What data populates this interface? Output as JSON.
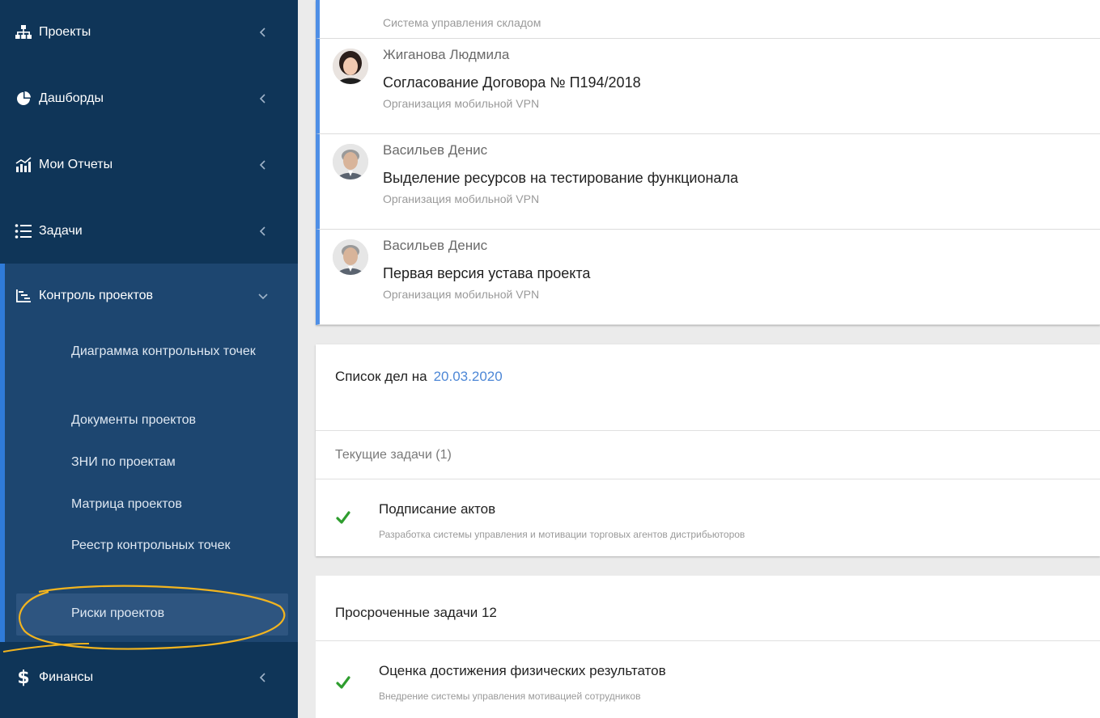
{
  "sidebar": {
    "items": [
      {
        "label": "Проекты",
        "icon": "sitemap-icon"
      },
      {
        "label": "Дашборды",
        "icon": "pie-chart-icon"
      },
      {
        "label": "Мои Отчеты",
        "icon": "bar-chart-icon"
      },
      {
        "label": "Задачи",
        "icon": "list-icon"
      },
      {
        "label": "Контроль проектов",
        "icon": "gantt-icon"
      },
      {
        "label": "Финансы",
        "icon": "dollar-icon"
      }
    ],
    "subitems": [
      "Диаграмма контрольных точек",
      "Документы проектов",
      "ЗНИ по проектам",
      "Матрица проектов",
      "Реестр контрольных точек",
      "Риски проектов"
    ]
  },
  "feed": {
    "top_subtitle": "Система управления складом",
    "items": [
      {
        "author": "Жиганова Людмила",
        "title": "Согласование Договора № П194/2018",
        "subtitle": "Организация мобильной VPN"
      },
      {
        "author": "Васильев Денис",
        "title": "Выделение ресурсов на тестирование функционала",
        "subtitle": "Организация мобильной VPN"
      },
      {
        "author": "Васильев Денис",
        "title": "Первая версия устава проекта",
        "subtitle": "Организация мобильной VPN"
      }
    ]
  },
  "todo": {
    "title": "Список дел на",
    "date": "20.03.2020",
    "current_header": "Текущие задачи (1)",
    "current_tasks": [
      {
        "title": "Подписание актов",
        "subtitle": "Разработка системы управления и мотивации торговых агентов дистрибьюторов"
      }
    ]
  },
  "overdue": {
    "title": "Просроченные задачи 12",
    "tasks": [
      {
        "title": "Оценка достижения физических результатов",
        "subtitle": "Внедрение системы управления мотивацией сотрудников"
      }
    ]
  },
  "colors": {
    "sidebar_bg": "#0f3558",
    "sidebar_group_bg": "#1d4670",
    "accent_blue": "#4f8fe6",
    "check_green": "#2e9d2e",
    "highlight": "#f2b41f"
  }
}
